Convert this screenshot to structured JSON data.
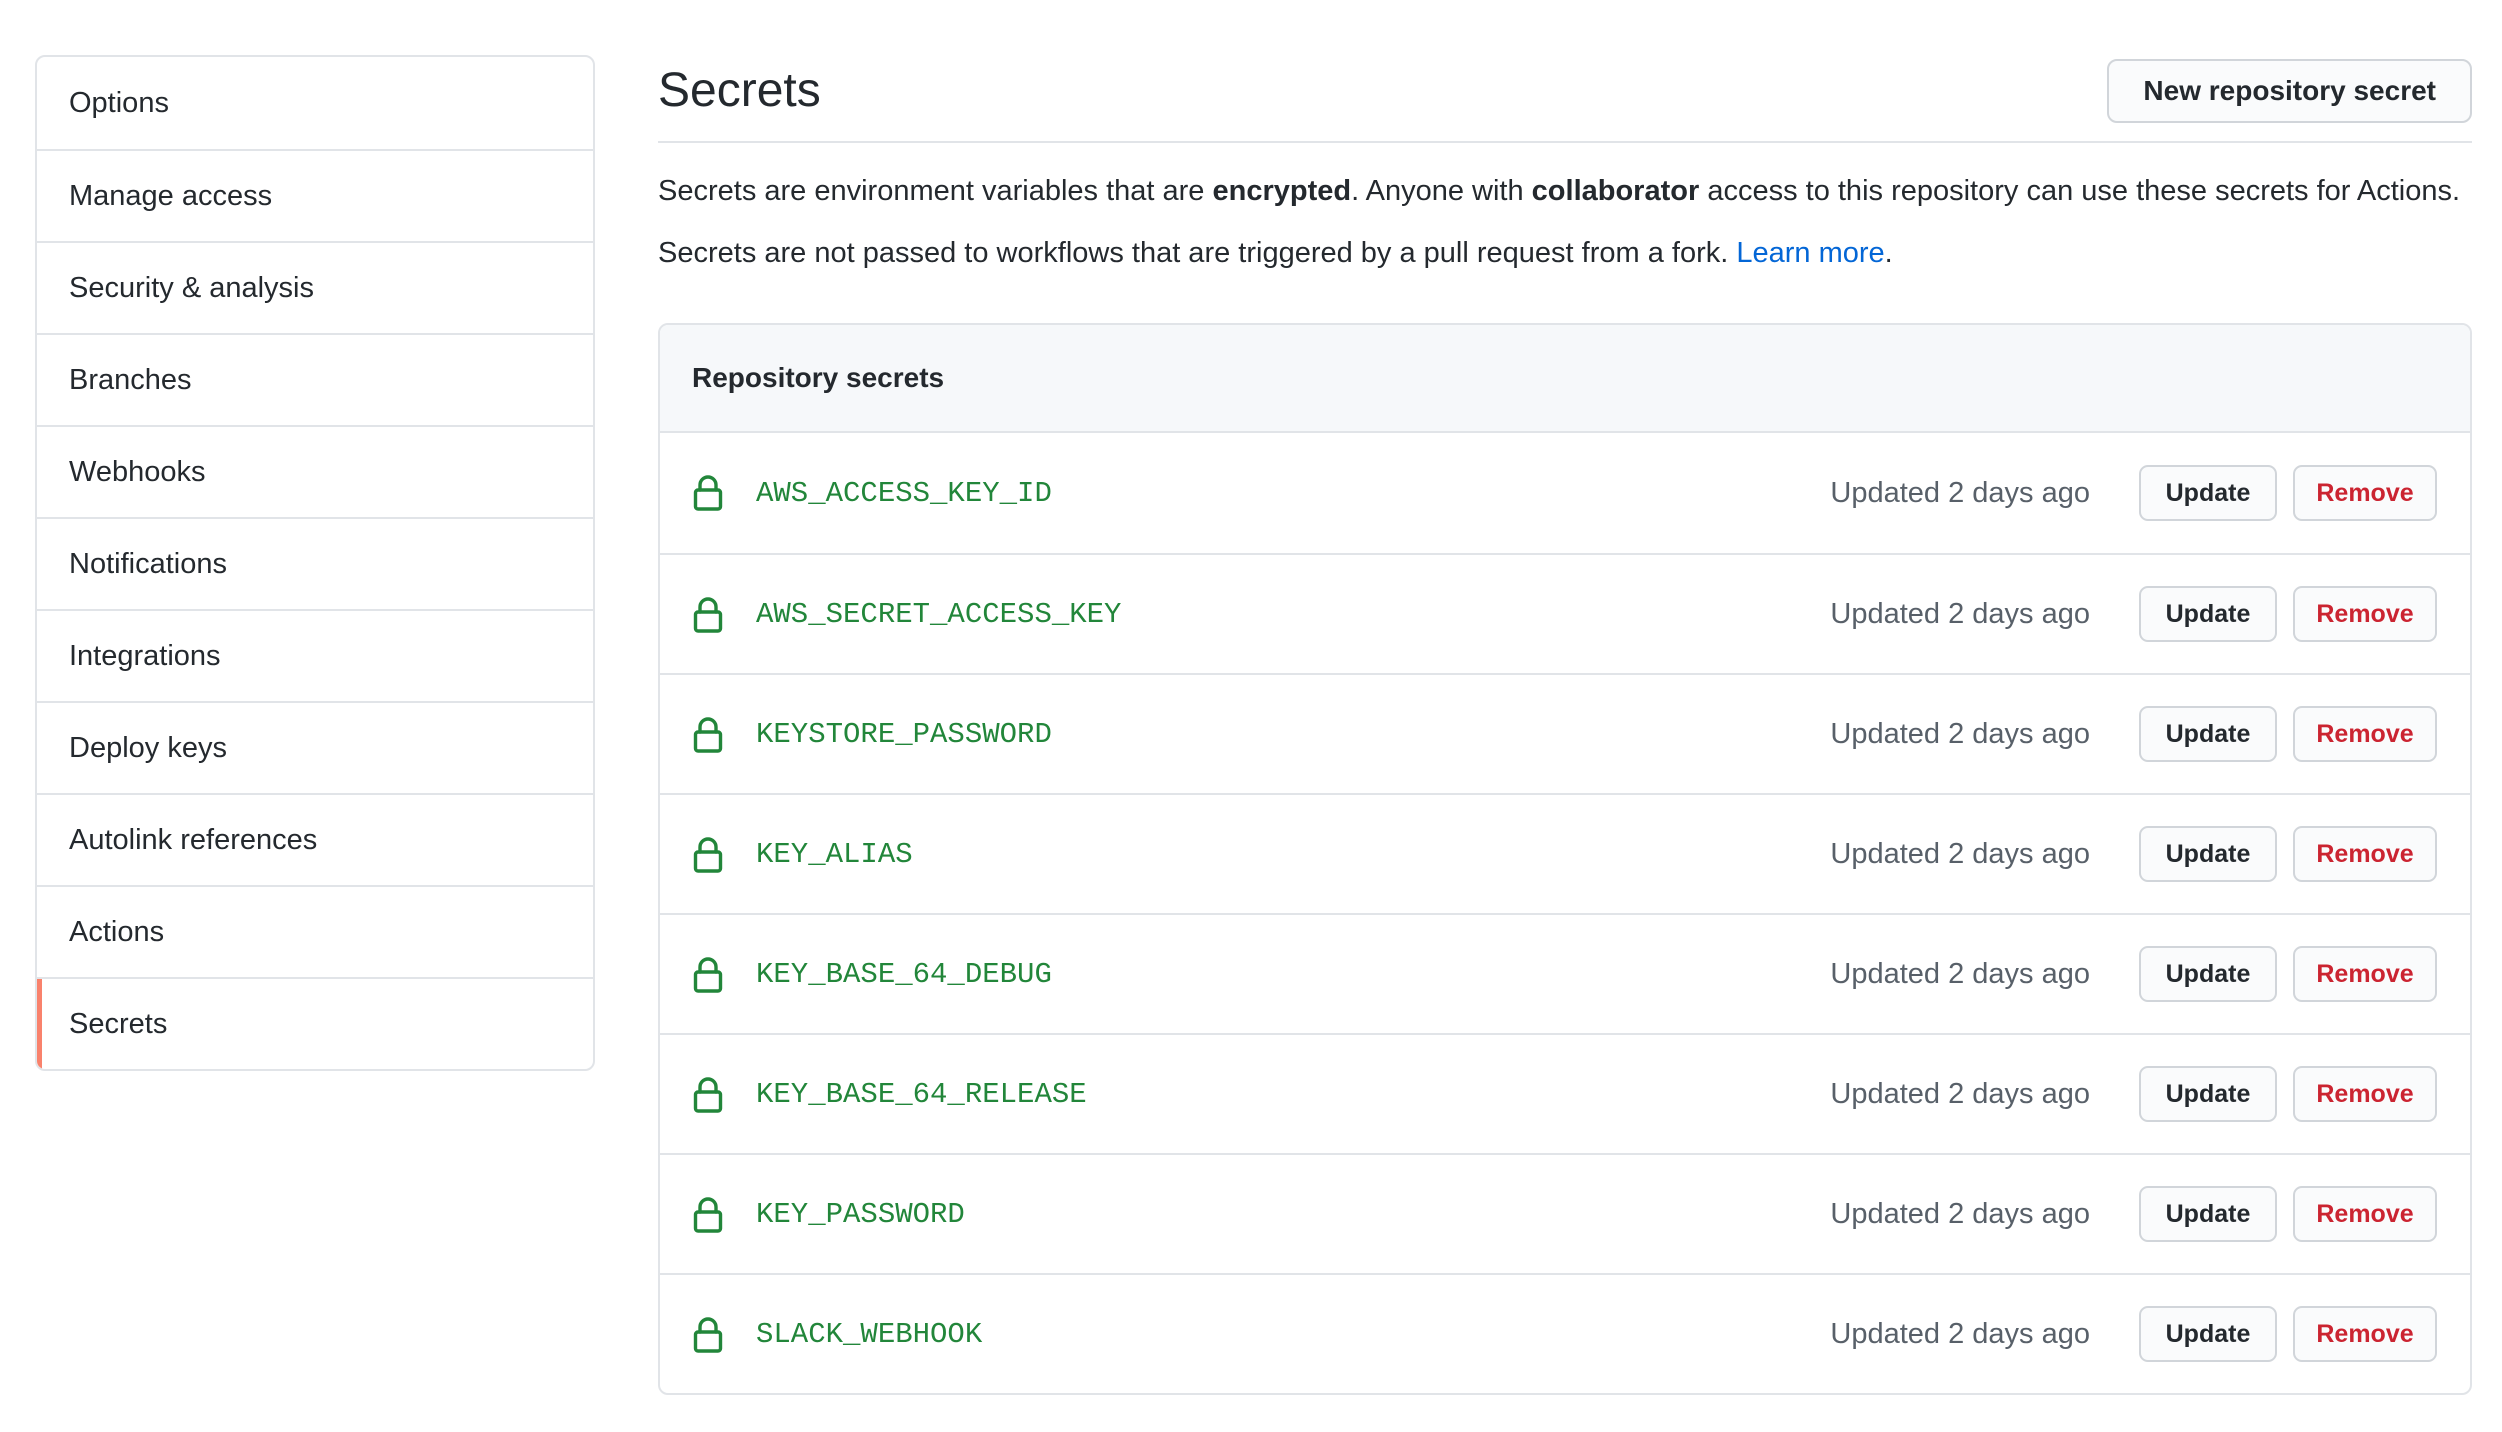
{
  "sidebar": {
    "items": [
      {
        "label": "Options",
        "active": false
      },
      {
        "label": "Manage access",
        "active": false
      },
      {
        "label": "Security & analysis",
        "active": false
      },
      {
        "label": "Branches",
        "active": false
      },
      {
        "label": "Webhooks",
        "active": false
      },
      {
        "label": "Notifications",
        "active": false
      },
      {
        "label": "Integrations",
        "active": false
      },
      {
        "label": "Deploy keys",
        "active": false
      },
      {
        "label": "Autolink references",
        "active": false
      },
      {
        "label": "Actions",
        "active": false
      },
      {
        "label": "Secrets",
        "active": true
      }
    ]
  },
  "header": {
    "title": "Secrets",
    "new_button_label": "New repository secret"
  },
  "description": {
    "line1_part1": "Secrets are environment variables that are ",
    "line1_bold1": "encrypted",
    "line1_part2": ". Anyone with ",
    "line1_bold2": "collaborator",
    "line1_part3": " access to this repository can use these secrets for Actions.",
    "line2_text": "Secrets are not passed to workflows that are triggered by a pull request from a fork. ",
    "line2_link": "Learn more",
    "line2_end": "."
  },
  "secrets_box": {
    "header": "Repository secrets",
    "update_label": "Update",
    "remove_label": "Remove",
    "rows": [
      {
        "name": "AWS_ACCESS_KEY_ID",
        "updated": "Updated 2 days ago"
      },
      {
        "name": "AWS_SECRET_ACCESS_KEY",
        "updated": "Updated 2 days ago"
      },
      {
        "name": "KEYSTORE_PASSWORD",
        "updated": "Updated 2 days ago"
      },
      {
        "name": "KEY_ALIAS",
        "updated": "Updated 2 days ago"
      },
      {
        "name": "KEY_BASE_64_DEBUG",
        "updated": "Updated 2 days ago"
      },
      {
        "name": "KEY_BASE_64_RELEASE",
        "updated": "Updated 2 days ago"
      },
      {
        "name": "KEY_PASSWORD",
        "updated": "Updated 2 days ago"
      },
      {
        "name": "SLACK_WEBHOOK",
        "updated": "Updated 2 days ago"
      }
    ]
  },
  "icons": {
    "row_icon": "lock-icon"
  },
  "colors": {
    "accent_active": "#f9826c",
    "secret_name": "#22863a",
    "link": "#0366d6",
    "remove": "#cb2431"
  }
}
